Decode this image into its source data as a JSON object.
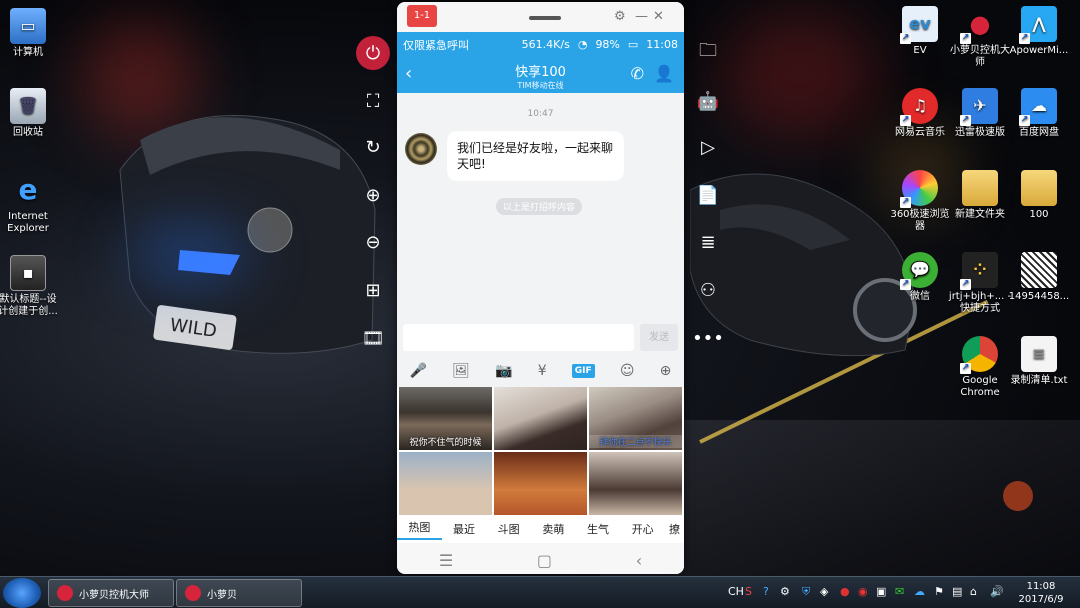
{
  "desktop_left": [
    {
      "label": "计算机",
      "icon": "computer-icon"
    },
    {
      "label": "回收站",
      "icon": "recycle-bin-icon"
    },
    {
      "label": "Internet Explorer",
      "icon": "ie-icon"
    },
    {
      "label": "默认标题--设计创建于创...",
      "icon": "image-file-icon"
    }
  ],
  "desktop_right": [
    {
      "label": "EV",
      "icon": "ev-icon"
    },
    {
      "label": "小萝贝控机大师",
      "icon": "app-icon"
    },
    {
      "label": "ApowerMi...",
      "icon": "apowermirror-icon"
    },
    {
      "label": "网易云音乐",
      "icon": "netease-music-icon"
    },
    {
      "label": "迅雷极速版",
      "icon": "thunder-icon"
    },
    {
      "label": "百度网盘",
      "icon": "baidu-cloud-icon"
    },
    {
      "label": "360极速浏览器",
      "icon": "360-browser-icon"
    },
    {
      "label": "新建文件夹",
      "icon": "folder-icon"
    },
    {
      "label": "100",
      "icon": "folder-icon"
    },
    {
      "label": "微信",
      "icon": "wechat-icon"
    },
    {
      "label": "jrtj+bjh+... - 快捷方式",
      "icon": "shortcut-icon"
    },
    {
      "label": "14954458...",
      "icon": "qr-image-icon"
    },
    {
      "label": "Google Chrome",
      "icon": "chrome-icon"
    },
    {
      "label": "录制清单.txt",
      "icon": "text-file-icon"
    }
  ],
  "phone": {
    "tag": "1-1",
    "status": {
      "left": "仅限紧急呼叫",
      "speed": "561.4K/s",
      "battery": "98%",
      "time": "11:08"
    },
    "header": {
      "title": "快享100",
      "subtitle": "TIM移动在线"
    },
    "chat": {
      "time": "10:47",
      "message": "我们已经是好友啦，一起来聊天吧!",
      "hint": "以上是打招呼内容"
    },
    "send_label": "发送",
    "gif_label": "GIF",
    "captions": [
      "祝你不住气的时候",
      "",
      "拜你在二点不快乐",
      "",
      "",
      ""
    ],
    "emoji_tabs": [
      "热图",
      "最近",
      "斗图",
      "卖萌",
      "生气",
      "开心",
      "撩"
    ]
  },
  "taskbar": {
    "buttons": [
      "小萝贝控机大师",
      "小萝贝"
    ],
    "ime": "CH",
    "time": "11:08",
    "date": "2017/6/9"
  },
  "colors": {
    "accent": "#2aa4e7",
    "power": "#c2213a",
    "window_tag": "#e84545"
  }
}
